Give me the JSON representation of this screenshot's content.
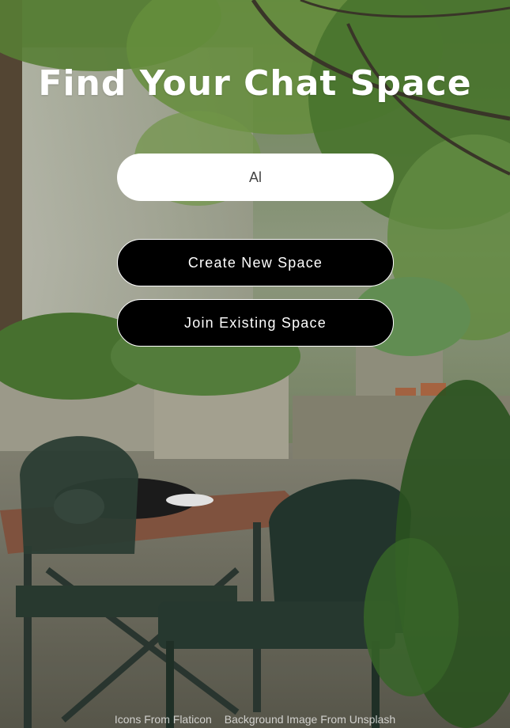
{
  "page": {
    "title": "Find Your Chat Space"
  },
  "form": {
    "name_value": "Al"
  },
  "actions": {
    "create_label": "Create New Space",
    "join_label": "Join Existing Space"
  },
  "footer": {
    "icons_credit": "Icons From Flaticon",
    "background_credit": "Background Image From Unsplash"
  },
  "colors": {
    "button_bg": "#000000",
    "button_text": "#ffffff",
    "input_bg": "#ffffff",
    "title_text": "#ffffff"
  }
}
